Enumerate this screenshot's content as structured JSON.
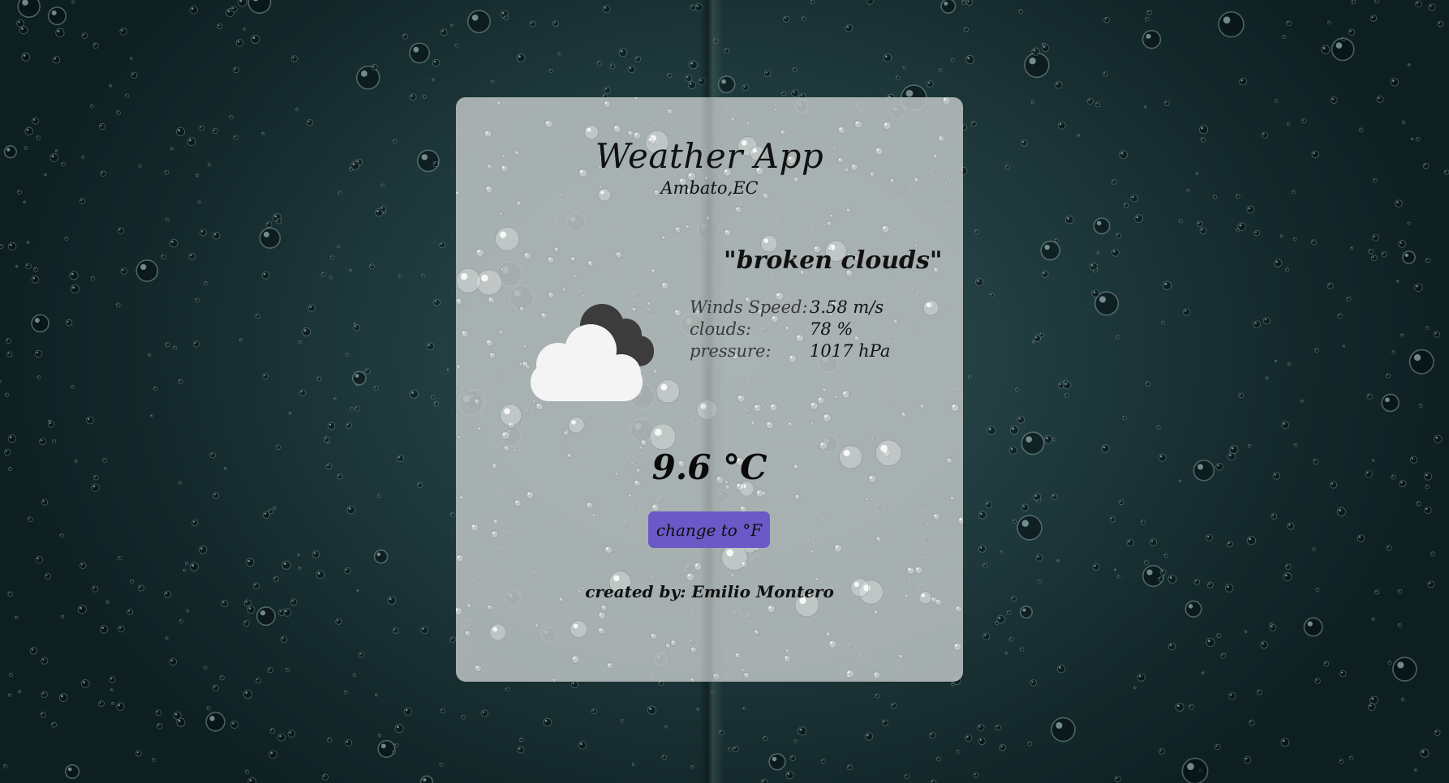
{
  "app": {
    "title": "Weather App",
    "location": "Ambato,EC"
  },
  "weather": {
    "description": "\"broken clouds\"",
    "icon": "broken-clouds-icon",
    "stats": [
      {
        "label": "Winds Speed:",
        "value": "3.58 m/s"
      },
      {
        "label": "clouds:",
        "value": "78 %"
      },
      {
        "label": "pressure:",
        "value": "1017 hPa"
      }
    ],
    "temperature": "9.6 °C"
  },
  "controls": {
    "unit_toggle_label": "change to °F",
    "accent_color": "#6a59c6"
  },
  "footer": {
    "credit": "created by: Emilio Montero"
  }
}
